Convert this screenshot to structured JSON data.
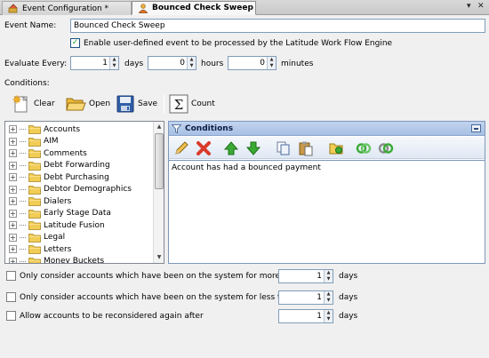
{
  "tabs": {
    "inactive_label": "Event Configuration *",
    "active_label": "Bounced Check Sweep",
    "strip_controls": {
      "dropdown": "▾",
      "close": "✕"
    }
  },
  "event_name": {
    "label": "Event Name:",
    "value": "Bounced Check Sweep"
  },
  "enable_checkbox": {
    "label": "Enable user-defined event to be processed by the Latitude Work Flow Engine",
    "checked": true
  },
  "evaluate": {
    "label": "Evaluate Every:",
    "days_value": "1",
    "days_unit": "days",
    "hours_value": "0",
    "hours_unit": "hours",
    "minutes_value": "0",
    "minutes_unit": "minutes"
  },
  "conditions_label": "Conditions:",
  "toolbar": {
    "clear": "Clear",
    "open": "Open",
    "save": "Save",
    "count": "Count"
  },
  "tree": {
    "items": [
      "Accounts",
      "AIM",
      "Comments",
      "Debt Forwarding",
      "Debt Purchasing",
      "Debtor Demographics",
      "Dialers",
      "Early Stage Data",
      "Latitude Fusion",
      "Legal",
      "Letters",
      "Money Buckets"
    ]
  },
  "conditions_panel": {
    "title": "Conditions",
    "items": [
      "Account has had a bounced payment"
    ]
  },
  "options": [
    {
      "label": "Only consider accounts which have been on the system for more than",
      "value": "1",
      "unit": "days"
    },
    {
      "label": "Only consider accounts which have been on the system for less than",
      "value": "1",
      "unit": "days"
    },
    {
      "label": "Allow accounts to be reconsidered again after",
      "value": "1",
      "unit": "days"
    }
  ],
  "colors": {
    "accent_blue": "#a8c0e4",
    "folder_yellow": "#f2cd55",
    "delete_red": "#d93a2b",
    "arrow_green": "#3aaa35"
  }
}
